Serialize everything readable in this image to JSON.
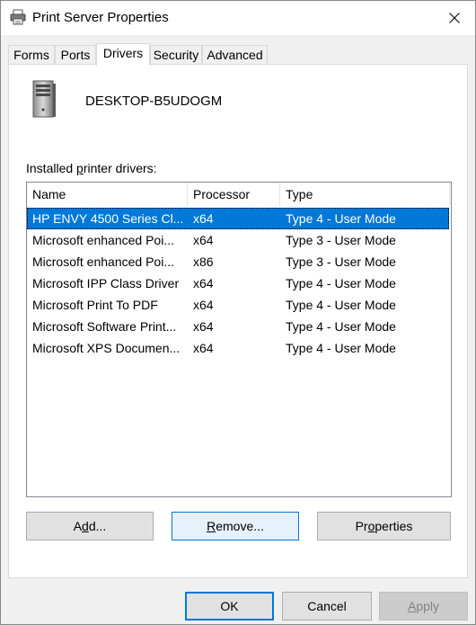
{
  "window": {
    "title": "Print Server Properties",
    "close_label": "✕"
  },
  "tabs": [
    {
      "label": "Forms",
      "active": false
    },
    {
      "label": "Ports",
      "active": false
    },
    {
      "label": "Drivers",
      "active": true
    },
    {
      "label": "Security",
      "active": false
    },
    {
      "label": "Advanced",
      "active": false
    }
  ],
  "server": {
    "name": "DESKTOP-B5UDOGM"
  },
  "drivers": {
    "label_pre": "Installed ",
    "label_u": "p",
    "label_post": "rinter drivers:",
    "columns": [
      "Name",
      "Processor",
      "Type"
    ],
    "rows": [
      {
        "name": "HP ENVY 4500 Series Cl...",
        "processor": "x64",
        "type": "Type 4 - User Mode",
        "selected": true
      },
      {
        "name": "Microsoft enhanced Poi...",
        "processor": "x64",
        "type": "Type 3 - User Mode",
        "selected": false
      },
      {
        "name": "Microsoft enhanced Poi...",
        "processor": "x86",
        "type": "Type 3 - User Mode",
        "selected": false
      },
      {
        "name": "Microsoft IPP Class Driver",
        "processor": "x64",
        "type": "Type 4 - User Mode",
        "selected": false
      },
      {
        "name": "Microsoft Print To PDF",
        "processor": "x64",
        "type": "Type 4 - User Mode",
        "selected": false
      },
      {
        "name": "Microsoft Software Print...",
        "processor": "x64",
        "type": "Type 4 - User Mode",
        "selected": false
      },
      {
        "name": "Microsoft XPS Documen...",
        "processor": "x64",
        "type": "Type 4 - User Mode",
        "selected": false
      }
    ]
  },
  "buttons": {
    "add": {
      "pre": "A",
      "u": "d",
      "post": "d..."
    },
    "remove": {
      "pre": "",
      "u": "R",
      "post": "emove..."
    },
    "properties": {
      "pre": "Pr",
      "u": "o",
      "post": "perties"
    },
    "ok": "OK",
    "cancel": "Cancel",
    "apply": {
      "pre": "",
      "u": "A",
      "post": "pply"
    }
  }
}
